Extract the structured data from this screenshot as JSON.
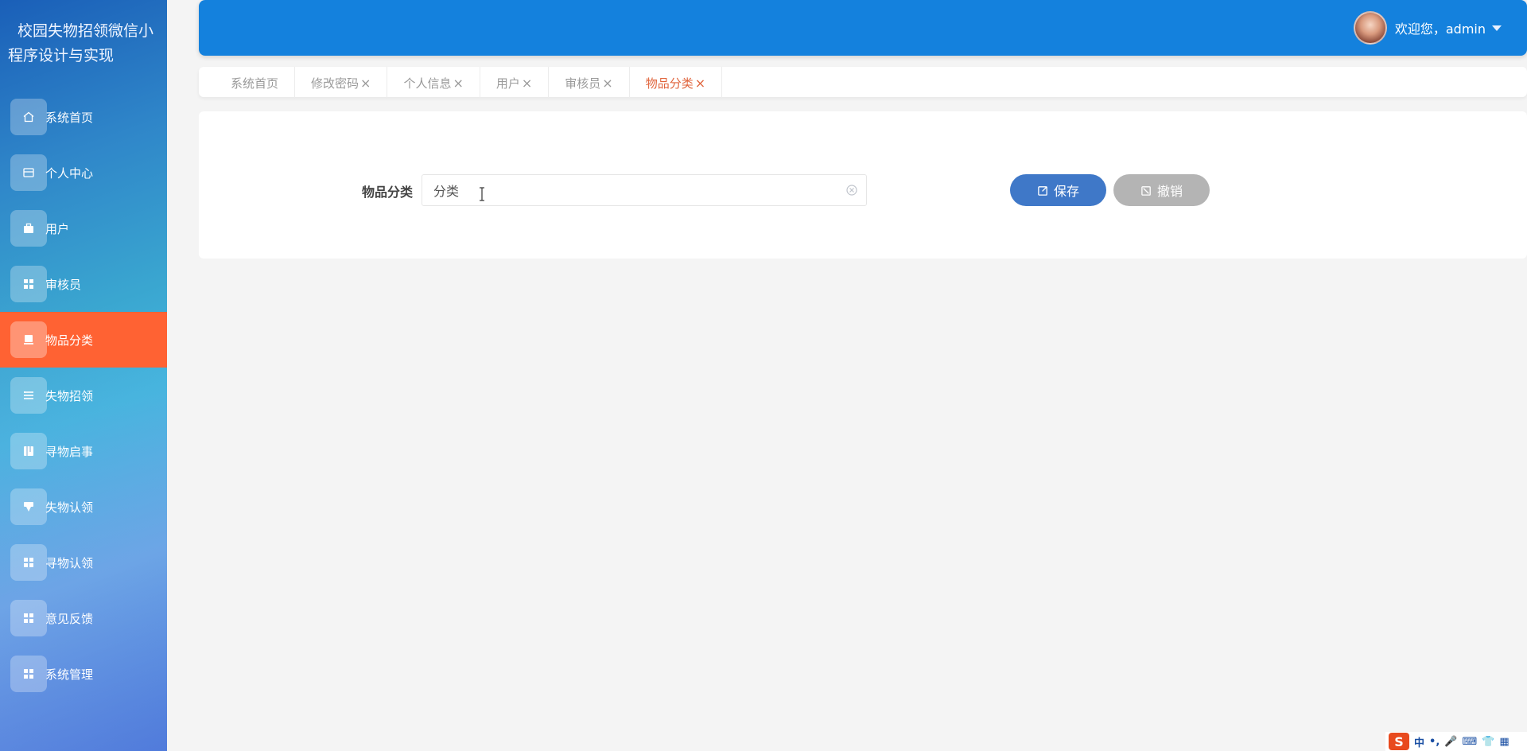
{
  "sidebar": {
    "title": "校园失物招领微信小程序设计与实现",
    "items": [
      {
        "label": "系统首页",
        "icon": "home-icon"
      },
      {
        "label": "个人中心",
        "icon": "card-icon"
      },
      {
        "label": "用户",
        "icon": "briefcase-icon"
      },
      {
        "label": "审核员",
        "icon": "grid-icon"
      },
      {
        "label": "物品分类",
        "icon": "tray-icon",
        "active": true
      },
      {
        "label": "失物招领",
        "icon": "list-icon"
      },
      {
        "label": "寻物启事",
        "icon": "book-icon"
      },
      {
        "label": "失物认领",
        "icon": "stamp-icon"
      },
      {
        "label": "寻物认领",
        "icon": "grid-icon"
      },
      {
        "label": "意见反馈",
        "icon": "grid-icon"
      },
      {
        "label": "系统管理",
        "icon": "grid-icon"
      }
    ]
  },
  "header": {
    "welcome": "欢迎您，admin"
  },
  "tabs": [
    {
      "label": "系统首页",
      "closable": false
    },
    {
      "label": "修改密码",
      "closable": true
    },
    {
      "label": "个人信息",
      "closable": true
    },
    {
      "label": "用户",
      "closable": true
    },
    {
      "label": "审核员",
      "closable": true
    },
    {
      "label": "物品分类",
      "closable": true,
      "active": true
    }
  ],
  "form": {
    "label": "物品分类",
    "value": "分类",
    "save_label": "保存",
    "cancel_label": "撤销"
  },
  "ime": {
    "logo": "S",
    "mode": "中"
  },
  "colors": {
    "header": "#1481dd",
    "active_menu": "#ff6233",
    "active_tab": "#e0643c",
    "save_button": "#3f78c8",
    "cancel_button": "#b4b4b4"
  }
}
